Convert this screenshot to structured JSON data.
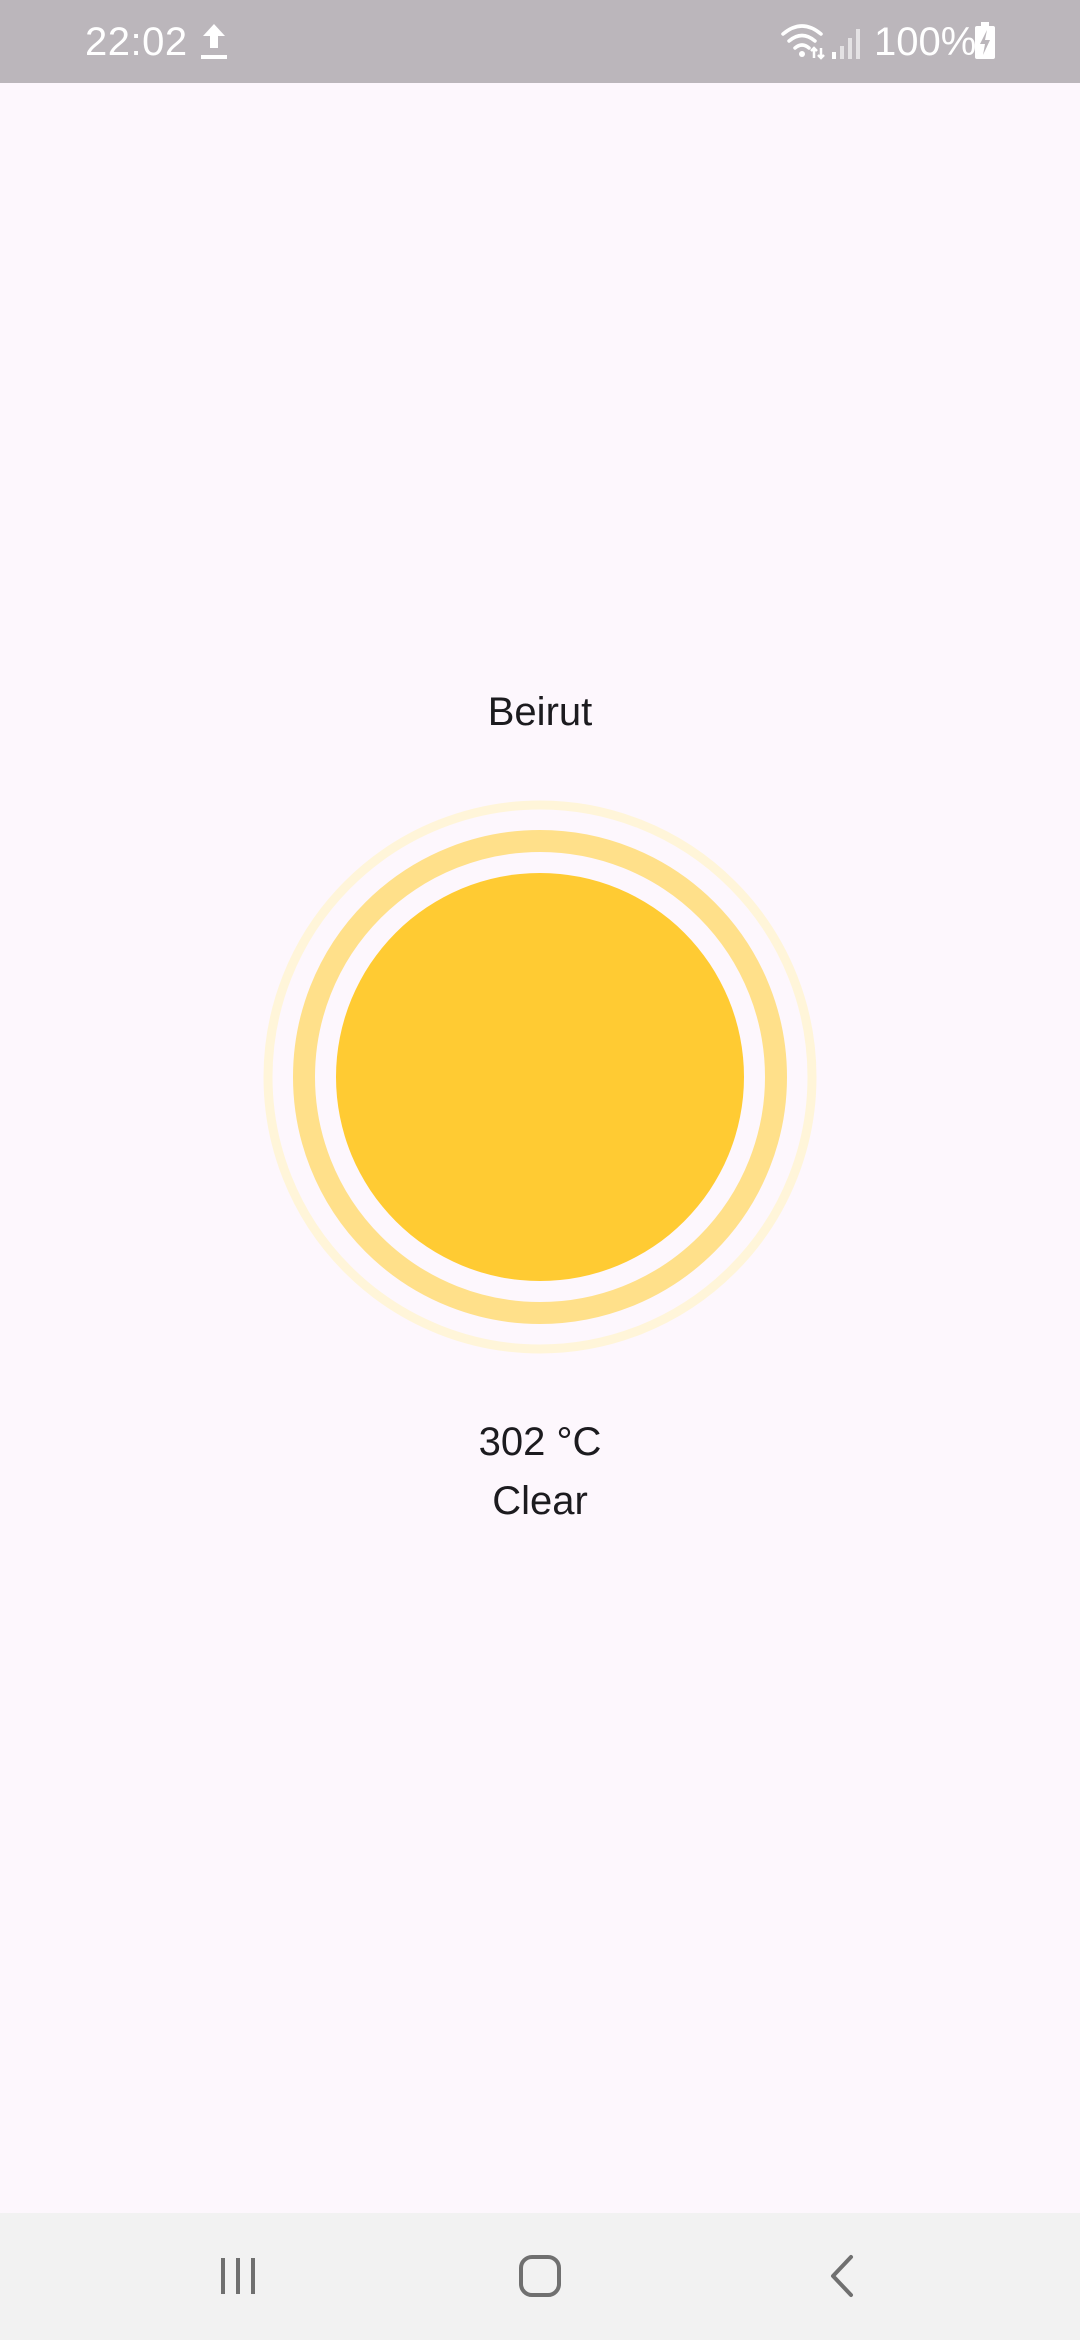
{
  "status_bar": {
    "time": "22:02",
    "battery": "100%",
    "icons": [
      "upload-icon",
      "wifi-icon",
      "signal-icon",
      "battery-charging-icon"
    ]
  },
  "weather": {
    "city": "Beirut",
    "temperature": "302 °C",
    "condition": "Clear",
    "icon": "sun-icon"
  },
  "colors": {
    "background": "#fdf7fd",
    "status_bar": "#bbb6bb",
    "sun_core": "#ffcb33",
    "sun_ring_inner": "#ffe08a",
    "sun_ring_outer": "#fff5d9",
    "nav_bar": "#f2f2f2"
  },
  "nav_bar": {
    "icons": [
      "recent-apps-icon",
      "home-icon",
      "back-icon"
    ]
  }
}
